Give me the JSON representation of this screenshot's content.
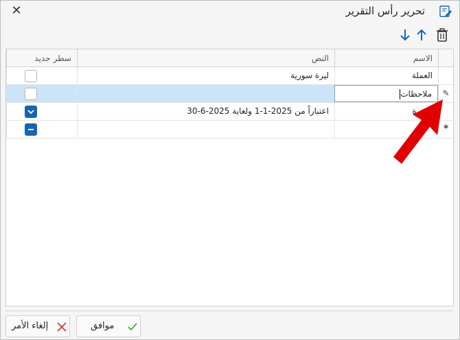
{
  "window": {
    "title": "تحرير رأس التقرير"
  },
  "toolbar": {
    "delete_icon": "trash-icon",
    "up_icon": "arrow-up-icon",
    "down_icon": "arrow-down-icon"
  },
  "grid": {
    "columns": {
      "name": "الاسم",
      "text": "النص",
      "new_line": "سطر جديد"
    },
    "rows": [
      {
        "name": "العملة",
        "text": "ليرة سورية",
        "new_line": false
      },
      {
        "name": "ملاحظات",
        "text": "",
        "new_line": false,
        "editing": true
      },
      {
        "name": "الفترة",
        "text": "اعتباراً من 2025-1-1 ولغاية 2025-6-30",
        "new_line": true
      },
      {
        "name": "",
        "text": "",
        "new_line": "indeterminate",
        "new_row": true
      }
    ],
    "edit_marker": "✎",
    "new_marker": "*"
  },
  "buttons": {
    "ok": "موافق",
    "cancel": "إلغاء الأمر"
  },
  "colors": {
    "accent": "#1565b0",
    "selection": "#cce4f7",
    "annotation_arrow": "#e00000",
    "ok_check": "#3a9a3a",
    "cancel_x": "#d23030"
  }
}
